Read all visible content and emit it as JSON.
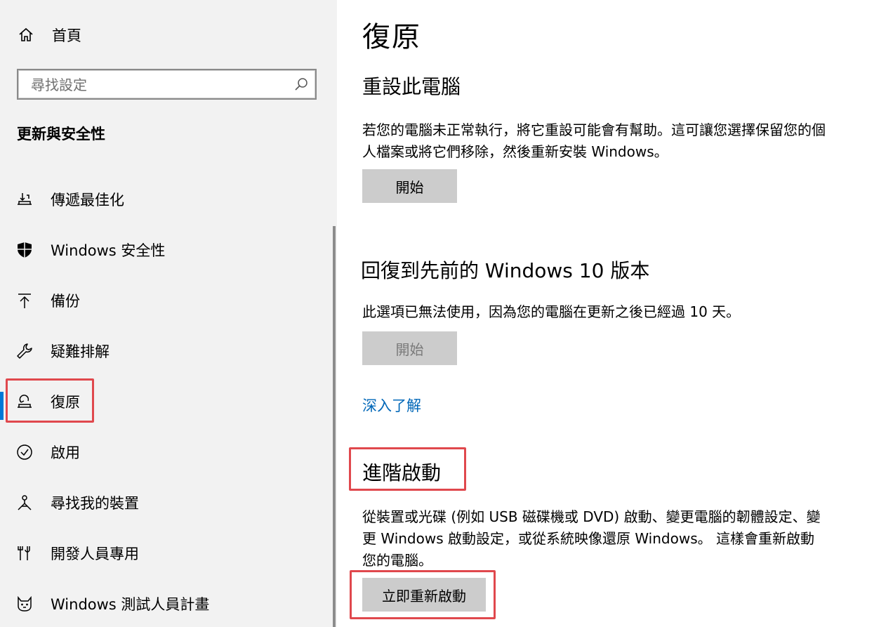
{
  "sidebar": {
    "home_label": "首頁",
    "search_placeholder": "尋找設定",
    "section_title": "更新與安全性",
    "items": [
      {
        "label": "傳遞最佳化",
        "icon": "delivery-optimization-icon"
      },
      {
        "label": "Windows 安全性",
        "icon": "shield-icon"
      },
      {
        "label": "備份",
        "icon": "backup-arrow-up-icon"
      },
      {
        "label": "疑難排解",
        "icon": "wrench-icon"
      },
      {
        "label": "復原",
        "icon": "recovery-icon",
        "active": true
      },
      {
        "label": "啟用",
        "icon": "check-circle-icon"
      },
      {
        "label": "尋找我的裝置",
        "icon": "find-device-icon"
      },
      {
        "label": "開發人員專用",
        "icon": "developer-tools-icon"
      },
      {
        "label": "Windows 測試人員計畫",
        "icon": "insider-cat-icon"
      }
    ]
  },
  "main": {
    "title": "復原",
    "reset": {
      "heading": "重設此電腦",
      "description": "若您的電腦未正常執行，將它重設可能會有幫助。這可讓您選擇保留您的個人檔案或將它們移除，然後重新安裝 Windows。",
      "button": "開始"
    },
    "rollback": {
      "heading": "回復到先前的 Windows 10 版本",
      "description": "此選項已無法使用，因為您的電腦在更新之後已經過 10 天。",
      "button": "開始",
      "button_disabled": true,
      "link": "深入了解"
    },
    "advanced": {
      "heading": "進階啟動",
      "description": "從裝置或光碟 (例如 USB 磁碟機或 DVD) 啟動、變更電腦的韌體設定、變更 Windows 啟動設定，或從系統映像還原 Windows。 這樣會重新啟動您的電腦。",
      "button": "立即重新啟動"
    }
  },
  "colors": {
    "accent": "#0078d7",
    "link": "#0067b8",
    "highlight": "#e0484d",
    "sidebar_bg": "#f2f2f2",
    "button_bg": "#cccccc"
  }
}
